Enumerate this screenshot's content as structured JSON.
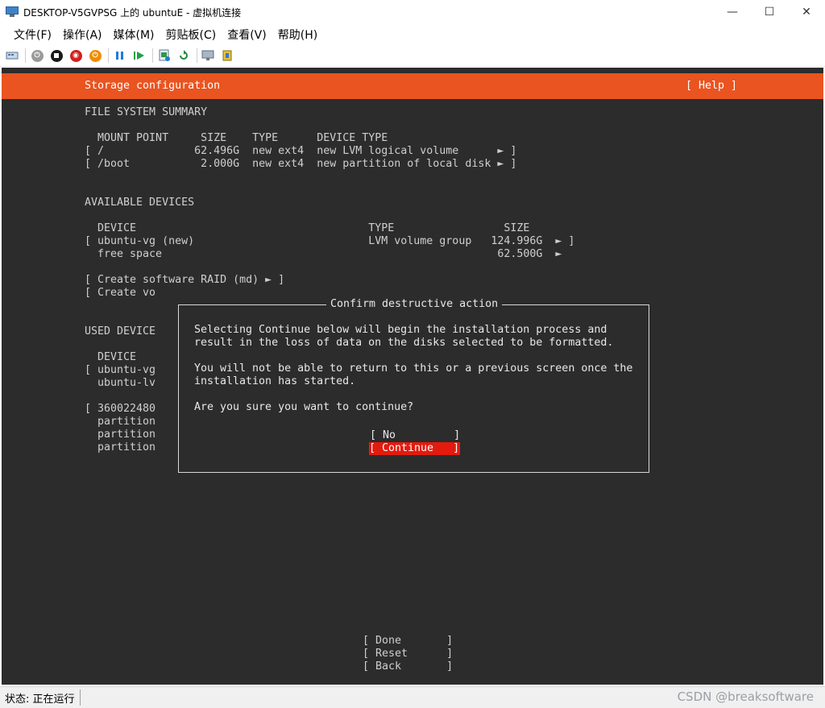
{
  "window": {
    "title": "DESKTOP-V5GVPSG 上的 ubuntuE - 虚拟机连接",
    "minimize": "—",
    "maximize": "☐",
    "close": "✕"
  },
  "menu": [
    "文件(F)",
    "操作(A)",
    "媒体(M)",
    "剪贴板(C)",
    "查看(V)",
    "帮助(H)"
  ],
  "toolbar": {
    "icons": [
      "ctrl-alt-del-icon",
      "start-icon",
      "turn-off-icon",
      "shutdown-icon",
      "power-icon",
      "pause-icon",
      "resume-icon",
      "checkpoint-icon",
      "revert-icon",
      "enhanced-session-icon",
      "share-icon"
    ]
  },
  "console": {
    "header_title": "Storage configuration",
    "header_help": "[ Help ]",
    "lines": [
      "FILE SYSTEM SUMMARY",
      "  MOUNT POINT     SIZE    TYPE      DEVICE TYPE",
      "[ /              62.496G  new ext4  new LVM logical volume      ► ]",
      "[ /boot           2.000G  new ext4  new partition of local disk ► ]",
      "AVAILABLE DEVICES",
      "  DEVICE                                    TYPE                 SIZE",
      "[ ubuntu-vg (new)                           LVM volume group   124.996G  ► ]",
      "  free space                                                    62.500G  ►",
      "[ Create software RAID (md) ► ]",
      "[ Create vo",
      "USED DEVICE",
      "  DEVICE",
      "[ ubuntu-vg",
      "  ubuntu-lv",
      "[ 360022480",
      "  partition",
      "  partition",
      "  partition",
      "[ Done       ]",
      "[ Reset      ]",
      "[ Back       ]"
    ],
    "dialog": {
      "title": "Confirm destructive action",
      "lines": [
        "Selecting Continue below will begin the installation process and",
        "result in the loss of data on the disks selected to be formatted.",
        "You will not be able to return to this or a previous screen once the",
        "installation has started.",
        "Are you sure you want to continue?"
      ],
      "no_button": "[ No         ]",
      "continue_button": "[ Continue   ]"
    }
  },
  "status": {
    "text": "状态: 正在运行"
  },
  "watermark": "CSDN @breaksoftware",
  "colors": {
    "header": "#e95420",
    "console_bg": "#2c2c2c",
    "selected_button": "#e31b0e"
  }
}
